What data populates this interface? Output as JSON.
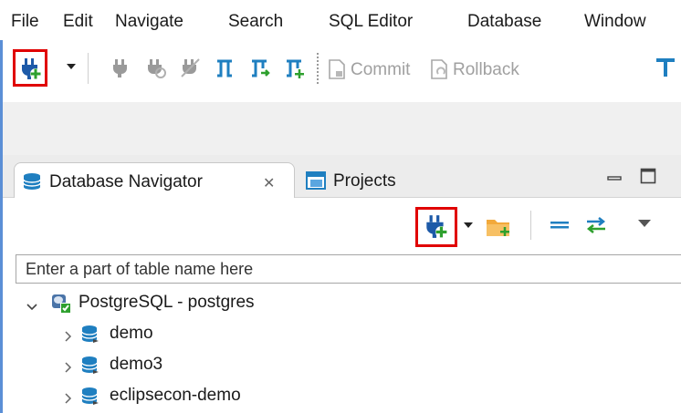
{
  "menu": [
    "File",
    "Edit",
    "Navigate",
    "Search",
    "SQL Editor",
    "Database",
    "Window"
  ],
  "toolbar": {
    "new_connection_icon": "plug-plus-icon",
    "commit_label": "Commit",
    "rollback_label": "Rollback"
  },
  "highlight_color": "#e00000",
  "view": {
    "tabs": [
      {
        "label": "Database Navigator",
        "active": true
      },
      {
        "label": "Projects",
        "active": false
      }
    ],
    "filter_placeholder": "Enter a part of table name here"
  },
  "tree": {
    "connection": {
      "label": "PostgreSQL - postgres",
      "expanded": true
    },
    "databases": [
      {
        "label": "demo"
      },
      {
        "label": "demo3"
      },
      {
        "label": "eclipsecon-demo"
      }
    ]
  }
}
